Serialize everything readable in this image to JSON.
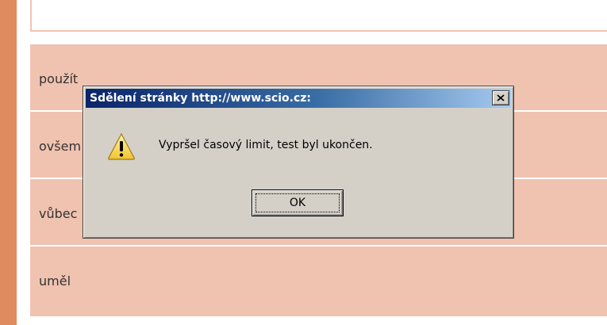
{
  "page": {
    "options": [
      {
        "label": "použít"
      },
      {
        "label": "ovšem"
      },
      {
        "label": "vůbec"
      },
      {
        "label": "uměl"
      }
    ]
  },
  "dialog": {
    "title": "Sdělení stránky http://www.scio.cz:",
    "message": "Vypršel časový limit, test byl ukončen.",
    "ok_label": "OK",
    "close_icon": "close-icon",
    "warning_icon": "warning-icon"
  },
  "colors": {
    "accent_bar": "#e08a60",
    "option_background": "#f0c2b0",
    "titlebar_start": "#0a246a",
    "titlebar_end": "#a6caf0",
    "dialog_background": "#d4d0c8"
  }
}
